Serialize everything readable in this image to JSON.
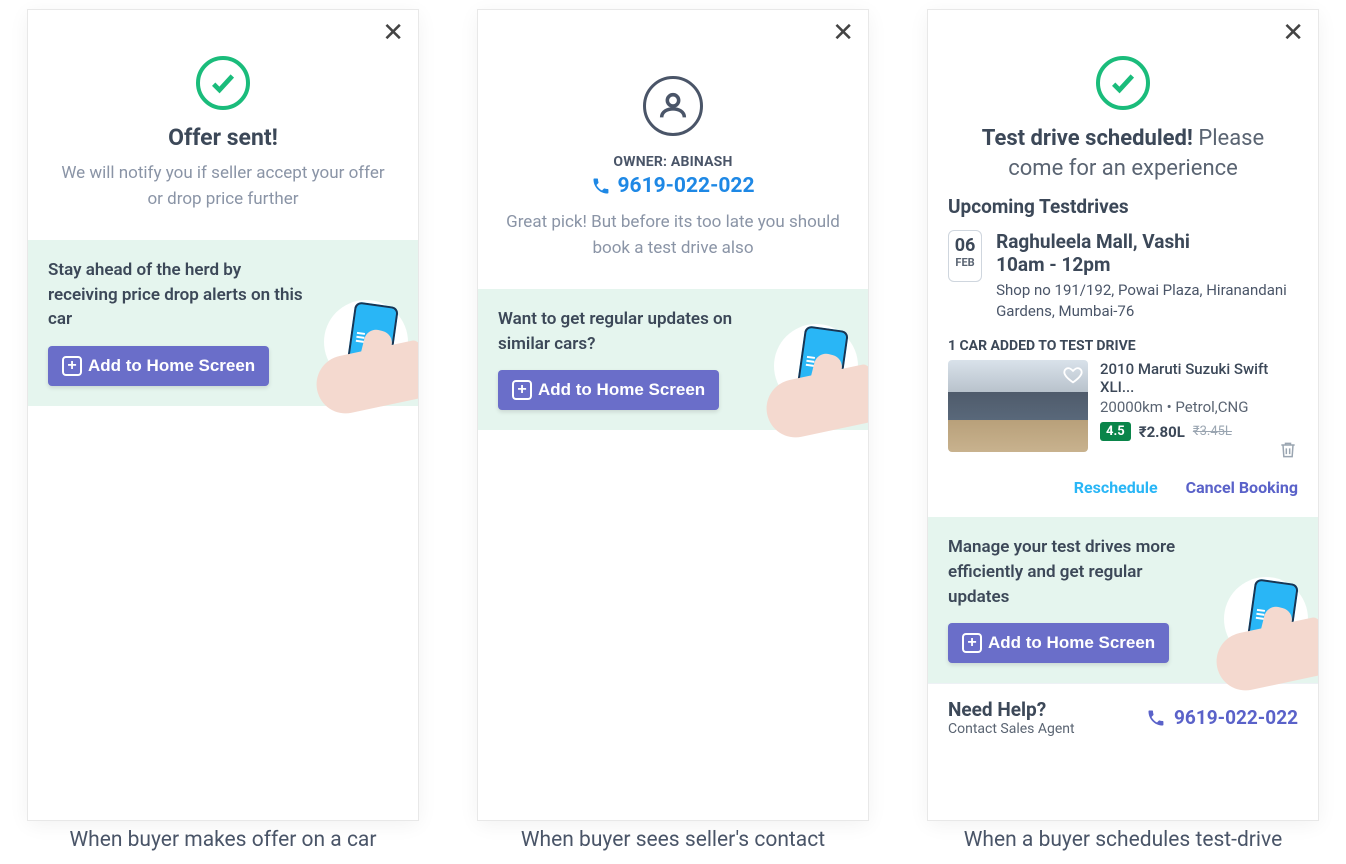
{
  "screen1": {
    "title": "Offer sent!",
    "subtitle": "We will notify you if seller accept your offer or drop price further",
    "banner_text": "Stay ahead of the herd by receiving price drop alerts on this car",
    "cta": "Add to Home Screen",
    "caption": "When buyer makes offer on a car"
  },
  "screen2": {
    "owner_label": "OWNER: ABINASH",
    "phone": "9619-022-022",
    "subtitle": "Great pick! But before its too late you should book a test drive also",
    "banner_text": "Want to get regular updates on similar cars?",
    "cta": "Add to Home Screen",
    "caption": "When buyer sees seller's contact"
  },
  "screen3": {
    "title_bold": "Test drive scheduled!",
    "title_rest": " Please come for an experience",
    "section": "Upcoming Testdrives",
    "date_day": "06",
    "date_month": "FEB",
    "location": "Raghuleela Mall, Vashi",
    "time": "10am - 12pm",
    "address": "Shop no 191/192, Powai Plaza, Hiranandani Gardens, Mumbai-76",
    "car_added_label": "1 CAR ADDED TO TEST DRIVE",
    "car_name": "2010 Maruti Suzuki Swift XLI...",
    "car_sub": "20000km • Petrol,CNG",
    "rating": "4.5",
    "price": "₹2.80L",
    "price_old": "₹3.45L",
    "action_reschedule": "Reschedule",
    "action_cancel": "Cancel Booking",
    "banner_text": "Manage your test drives more efficiently and get regular updates",
    "cta": "Add to Home Screen",
    "help_title": "Need Help?",
    "help_sub": "Contact Sales Agent",
    "help_phone": "9619-022-022",
    "caption": "When a buyer schedules test-drive"
  }
}
